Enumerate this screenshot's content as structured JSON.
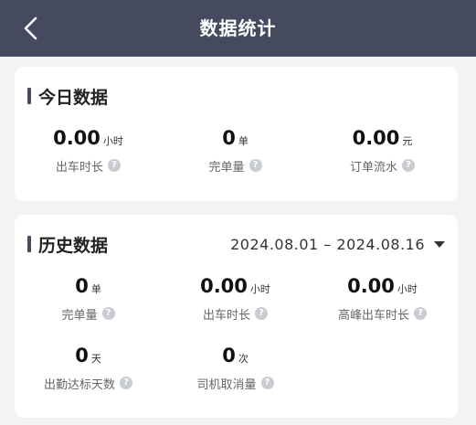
{
  "header": {
    "title": "数据统计"
  },
  "icons": {
    "back": "chevron-left-icon",
    "help": "question-circle-icon",
    "dropdown": "caret-down-icon"
  },
  "colors": {
    "header_bg": "#454a5e",
    "accent_bar": "#454a5e",
    "page_bg": "#f2f3f5"
  },
  "today": {
    "title": "今日数据",
    "stats": [
      {
        "value": "0.00",
        "unit": "小时",
        "label": "出车时长",
        "help": "?"
      },
      {
        "value": "0",
        "unit": "单",
        "label": "完单量",
        "help": "?"
      },
      {
        "value": "0.00",
        "unit": "元",
        "label": "订单流水",
        "help": "?"
      }
    ]
  },
  "history": {
    "title": "历史数据",
    "date_range": "2024.08.01 – 2024.08.16",
    "stats": [
      {
        "value": "0",
        "unit": "单",
        "label": "完单量",
        "help": "?"
      },
      {
        "value": "0.00",
        "unit": "小时",
        "label": "出车时长",
        "help": "?"
      },
      {
        "value": "0.00",
        "unit": "小时",
        "label": "高峰出车时长",
        "help": "?"
      },
      {
        "value": "0",
        "unit": "天",
        "label": "出勤达标天数",
        "help": "?"
      },
      {
        "value": "0",
        "unit": "次",
        "label": "司机取消量",
        "help": "?"
      }
    ]
  }
}
